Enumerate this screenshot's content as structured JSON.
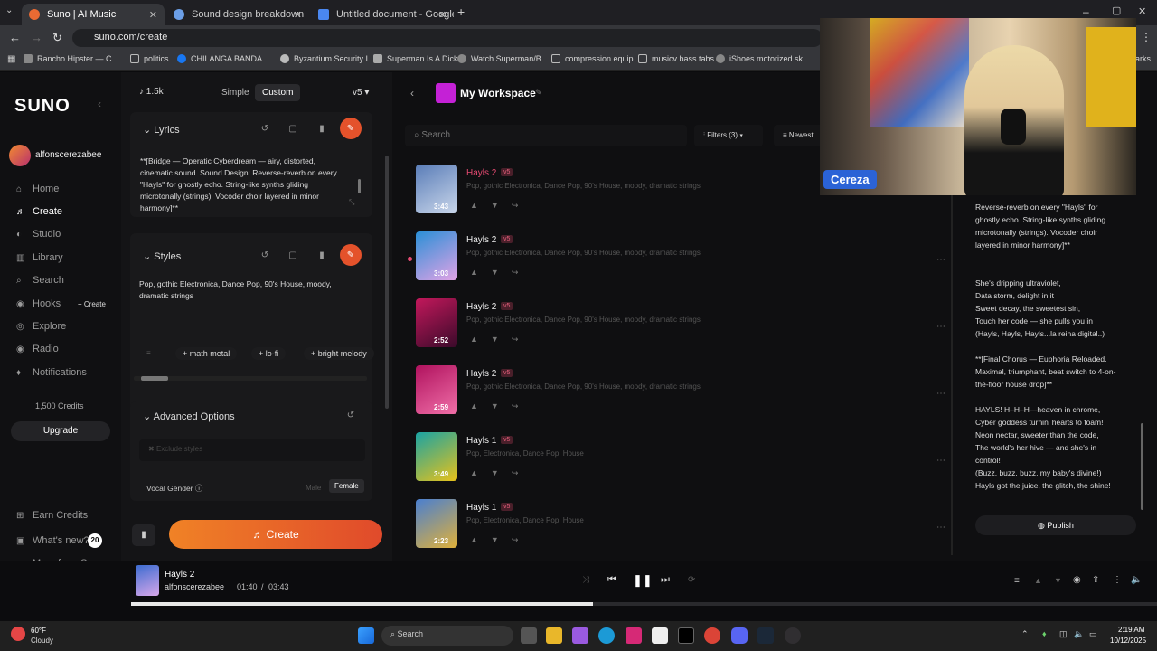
{
  "browser": {
    "tabs": [
      {
        "label": "Suno | AI Music"
      },
      {
        "label": "Sound design breakdown"
      },
      {
        "label": "Untitled document - Google D"
      }
    ],
    "new_tab": "+",
    "url": "suno.com/create",
    "bookmarks": [
      "Rancho Hipster — C...",
      "politics",
      "CHILANGA BANDA",
      "Byzantium Security I...",
      "Superman Is A Dick",
      "Watch Superman/B...",
      "compression equip",
      "musicv bass tabs",
      "iShoes motorized sk...",
      "arks"
    ]
  },
  "sidebar": {
    "logo": "SUNO",
    "collapse": "‹",
    "username": "alfonscerezabee",
    "items": [
      {
        "label": "Home",
        "icon": "⌂"
      },
      {
        "label": "Create",
        "icon": "♬"
      },
      {
        "label": "Studio",
        "icon": "◐"
      },
      {
        "label": "Library",
        "icon": "▥"
      },
      {
        "label": "Search",
        "icon": "⌕"
      },
      {
        "label": "Hooks",
        "icon": "◉"
      },
      {
        "label": "Explore",
        "icon": "◎"
      },
      {
        "label": "Radio",
        "icon": "◉"
      },
      {
        "label": "Notifications",
        "icon": "♦"
      }
    ],
    "hooks_create": "+ Create",
    "credits": "1,500 Credits",
    "upgrade": "Upgrade",
    "earn": "Earn Credits",
    "whats_new": "What's new?",
    "whats_new_count": "20",
    "more_from": "More from Suno"
  },
  "create": {
    "credits_count": "1.5k",
    "mode_simple": "Simple",
    "mode_custom": "Custom",
    "version": "v5",
    "lyrics_title": "Lyrics",
    "lyrics_text": "**[Bridge — Operatic Cyberdream — airy, distorted, cinematic sound. Sound Design: Reverse-reverb on every \"Hayls\" for ghostly echo. String-like synths gliding microtonally (strings). Vocoder choir layered in minor harmony]**",
    "styles_title": "Styles",
    "styles_text": "Pop, gothic Electronica, Dance Pop, 90's House, moody, dramatic strings",
    "chips": [
      "+ math metal",
      "+ lo-fi",
      "+ bright melody"
    ],
    "advanced": "Advanced Options",
    "exclude_placeholder": "Exclude styles",
    "vocal_gender": "Vocal Gender",
    "male": "Male",
    "female": "Female",
    "create_btn": "Create"
  },
  "workspace": {
    "title": "My Workspace",
    "search_placeholder": "Search",
    "filters": "Filters (3)",
    "sort": "Newest",
    "songs": [
      {
        "title": "Hayls 2",
        "badge": "v5",
        "tags": "Pop, gothic Electronica, Dance Pop, 90's House, moody, dramatic strings",
        "duration": "3:43",
        "color1": "#5a7db8",
        "color2": "#c9d6ea",
        "hot": true
      },
      {
        "title": "Hayls 2",
        "badge": "v5",
        "tags": "Pop, gothic Electronica, Dance Pop, 90's House, moody, dramatic strings",
        "duration": "3:03",
        "color1": "#2a8fd6",
        "color2": "#e2a3e6",
        "hot": false
      },
      {
        "title": "Hayls 2",
        "badge": "v5",
        "tags": "Pop, gothic Electronica, Dance Pop, 90's House, moody, dramatic strings",
        "duration": "2:52",
        "color1": "#c2185b",
        "color2": "#3a0a2a",
        "hot": false
      },
      {
        "title": "Hayls 2",
        "badge": "v5",
        "tags": "Pop, gothic Electronica, Dance Pop, 90's House, moody, dramatic strings",
        "duration": "2:59",
        "color1": "#b0125e",
        "color2": "#f06fa8",
        "hot": false
      },
      {
        "title": "Hayls 1",
        "badge": "v5",
        "tags": "Pop, Electronica, Dance Pop, House",
        "duration": "3:49",
        "color1": "#1aa3a3",
        "color2": "#e8c21a",
        "hot": false
      },
      {
        "title": "Hayls 1",
        "badge": "v5",
        "tags": "Pop, Electronica, Dance Pop, House",
        "duration": "2:23",
        "color1": "#4a7fd0",
        "color2": "#e0b13a",
        "hot": false
      }
    ]
  },
  "lyrics_panel": {
    "lines": [
      "Reverse-reverb on every \"Hayls\" for",
      "ghostly echo. String-like synths gliding",
      "microtonally (strings). Vocoder choir",
      "layered in minor harmony]**",
      "",
      "",
      "She's dripping ultraviolet,",
      "Data storm, delight in it",
      "Sweet decay, the sweetest sin,",
      "Touch her code — she pulls you in",
      "(Hayls, Hayls, Hayls...la reina digital..)",
      "",
      "**[Final Chorus — Euphoria Reloaded.",
      "Maximal, triumphant, beat switch to 4-on-",
      "the-floor house drop]**",
      "",
      "HAYLS! H–H–H—heaven in chrome,",
      "Cyber goddess turnin' hearts to foam!",
      "Neon nectar, sweeter than the code,",
      "The world's her hive — and she's in",
      "control!",
      "(Buzz, buzz, buzz, my baby's divine!)",
      "Hayls got the juice, the glitch, the shine!"
    ],
    "publish": "Publish"
  },
  "webcam": {
    "label": "Cereza"
  },
  "player": {
    "title": "Hayls 2",
    "artist": "alfonscerezabee",
    "elapsed": "01:40",
    "separator": "/",
    "total": "03:43",
    "progress": 0.45
  },
  "taskbar": {
    "temp": "60°F",
    "weather": "Cloudy",
    "search": "Search",
    "time": "2:19 AM",
    "date": "10/12/2025"
  }
}
